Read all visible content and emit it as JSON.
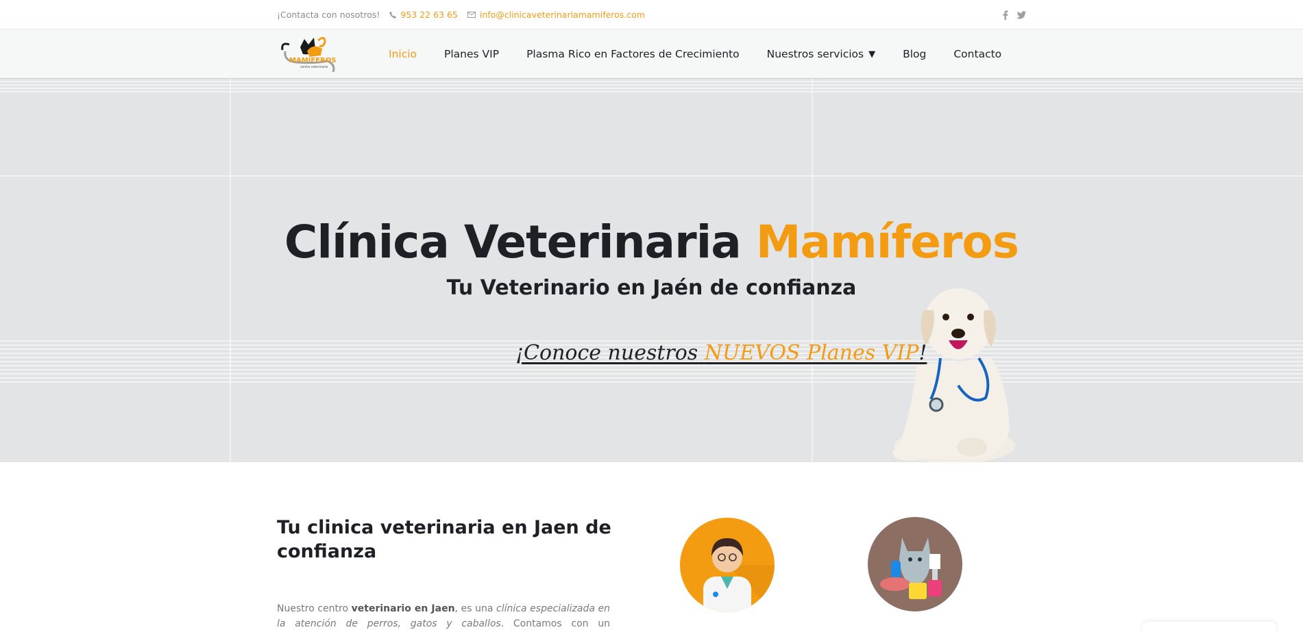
{
  "topbar": {
    "contact_lead": "¡Contacta con nosotros!",
    "phone": "953 22 63 65",
    "email": "info@clinicaveterinariamamiferos.com",
    "social": [
      "facebook-icon",
      "twitter-icon"
    ]
  },
  "logo": {
    "wordmark": "MAMÍFEROS",
    "tagline": "centro veterinario"
  },
  "nav": {
    "items": [
      {
        "label": "Inicio",
        "active": true
      },
      {
        "label": "Planes VIP"
      },
      {
        "label": "Plasma Rico en Factores de Crecimiento"
      },
      {
        "label": "Nuestros servicios",
        "caret": "▼"
      },
      {
        "label": "Blog"
      },
      {
        "label": "Contacto"
      }
    ]
  },
  "hero": {
    "title_main": "Clínica Veterinaria",
    "title_accent": "Mamíferos",
    "subtitle": "Tu Veterinario en Jaén de confianza",
    "cta_prefix": "¡Conoce nuestros",
    "cta_highlight": "NUEVOS Planes VIP",
    "cta_suffix": "!"
  },
  "intro": {
    "title": "Tu clinica veterinaria en Jaen de confianza",
    "p1": "Nuestro centro",
    "p2": "veterinario en Jaen",
    "p3": ", es una",
    "p4": "clínica especializada en la atención de perros, gatos y caballos",
    "p5": ". Contamos con un equipamiento"
  },
  "colors": {
    "accent": "#f39c12",
    "dark": "#1f1f26",
    "hero_bg": "#e3e4e6",
    "cat_circle": "#8d6e63"
  }
}
